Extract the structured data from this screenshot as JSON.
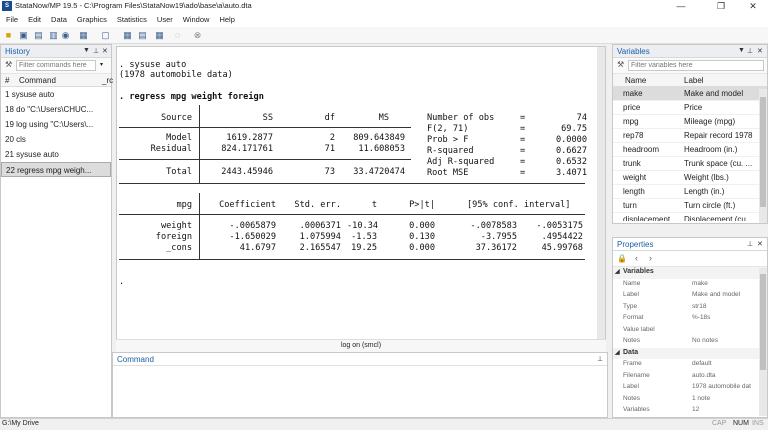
{
  "window": {
    "title": "StataNow/MP 19.5 - C:\\Program Files\\StataNow19\\ado\\base\\a\\auto.dta",
    "minimize": "—",
    "maximize": "❐",
    "close": "✕"
  },
  "menu": [
    "File",
    "Edit",
    "Data",
    "Graphics",
    "Statistics",
    "User",
    "Window",
    "Help"
  ],
  "history": {
    "title": "History",
    "filter_placeholder": "Filter commands here",
    "col_num": "#",
    "col_command": "Command",
    "col_rc": "_rc",
    "items": [
      {
        "num": "1",
        "cmd": "sysuse auto"
      },
      {
        "num": "18",
        "cmd": "do \"C:\\Users\\CHUC..."
      },
      {
        "num": "19",
        "cmd": "log using \"C:\\Users\\..."
      },
      {
        "num": "20",
        "cmd": "cls"
      },
      {
        "num": "21",
        "cmd": "sysuse auto"
      },
      {
        "num": "22",
        "cmd": "regress mpg weigh..."
      }
    ]
  },
  "results": {
    "cmd1": ". sysuse auto",
    "cmd1_out": "(1978 automobile data)",
    "cmd2": ". regress mpg weight foreign",
    "anova": {
      "source": "Source",
      "ss": "SS",
      "df": "df",
      "ms": "MS",
      "rows": [
        {
          "label": "Model",
          "ss": "1619.2877",
          "df": "2",
          "ms": "809.643849"
        },
        {
          "label": "Residual",
          "ss": "824.171761",
          "df": "71",
          "ms": "11.608053"
        }
      ],
      "total": {
        "label": "Total",
        "ss": "2443.45946",
        "df": "73",
        "ms": "33.4720474"
      }
    },
    "stats": [
      {
        "label": "Number of obs",
        "eq": "=",
        "val": "74"
      },
      {
        "label": "F(2, 71)",
        "eq": "=",
        "val": "69.75"
      },
      {
        "label": "Prob > F",
        "eq": "=",
        "val": "0.0000"
      },
      {
        "label": "R-squared",
        "eq": "=",
        "val": "0.6627"
      },
      {
        "label": "Adj R-squared",
        "eq": "=",
        "val": "0.6532"
      },
      {
        "label": "Root MSE",
        "eq": "=",
        "val": "3.4071"
      }
    ],
    "coef": {
      "dep": "mpg",
      "h_coef": "Coefficient",
      "h_se": "Std. err.",
      "h_t": "t",
      "h_p": "P>|t|",
      "h_ci": "[95% conf. interval]",
      "rows": [
        {
          "var": "weight",
          "coef": "-.0065879",
          "se": ".0006371",
          "t": "-10.34",
          "p": "0.000",
          "lo": "-.0078583",
          "hi": "-.0053175"
        },
        {
          "var": "foreign",
          "coef": "-1.650029",
          "se": "1.075994",
          "t": "-1.53",
          "p": "0.130",
          "lo": "-3.7955",
          "hi": ".4954422"
        },
        {
          "var": "_cons",
          "coef": "41.6797",
          "se": "2.165547",
          "t": "19.25",
          "p": "0.000",
          "lo": "37.36172",
          "hi": "45.99768"
        }
      ]
    },
    "prompt": "."
  },
  "logbar": "log on (smcl)",
  "command": {
    "title": "Command"
  },
  "variables": {
    "title": "Variables",
    "filter_placeholder": "Filter variables here",
    "col_name": "Name",
    "col_label": "Label",
    "items": [
      {
        "name": "make",
        "label": "Make and model"
      },
      {
        "name": "price",
        "label": "Price"
      },
      {
        "name": "mpg",
        "label": "Mileage (mpg)"
      },
      {
        "name": "rep78",
        "label": "Repair record 1978"
      },
      {
        "name": "headroom",
        "label": "Headroom (in.)"
      },
      {
        "name": "trunk",
        "label": "Trunk space (cu. ..."
      },
      {
        "name": "weight",
        "label": "Weight (lbs.)"
      },
      {
        "name": "length",
        "label": "Length (in.)"
      },
      {
        "name": "turn",
        "label": "Turn circle (ft.)"
      },
      {
        "name": "displacement",
        "label": "Displacement (cu..."
      }
    ]
  },
  "properties": {
    "title": "Properties",
    "sec_vars": "Variables",
    "vars": [
      {
        "k": "Name",
        "v": "make"
      },
      {
        "k": "Label",
        "v": "Make and model"
      },
      {
        "k": "Type",
        "v": "str18"
      },
      {
        "k": "Format",
        "v": "%-18s"
      },
      {
        "k": "Value label",
        "v": ""
      },
      {
        "k": "Notes",
        "v": "No notes"
      }
    ],
    "sec_data": "Data",
    "data": [
      {
        "k": "Frame",
        "v": "default"
      },
      {
        "k": "Filename",
        "v": "auto.dta"
      },
      {
        "k": "Label",
        "v": "1978 automobile dat"
      },
      {
        "k": "Notes",
        "v": "1 note"
      },
      {
        "k": "Variables",
        "v": "12"
      }
    ]
  },
  "status": {
    "path": "G:\\My Drive",
    "cap": "CAP",
    "num": "NUM",
    "ins": "INS"
  }
}
